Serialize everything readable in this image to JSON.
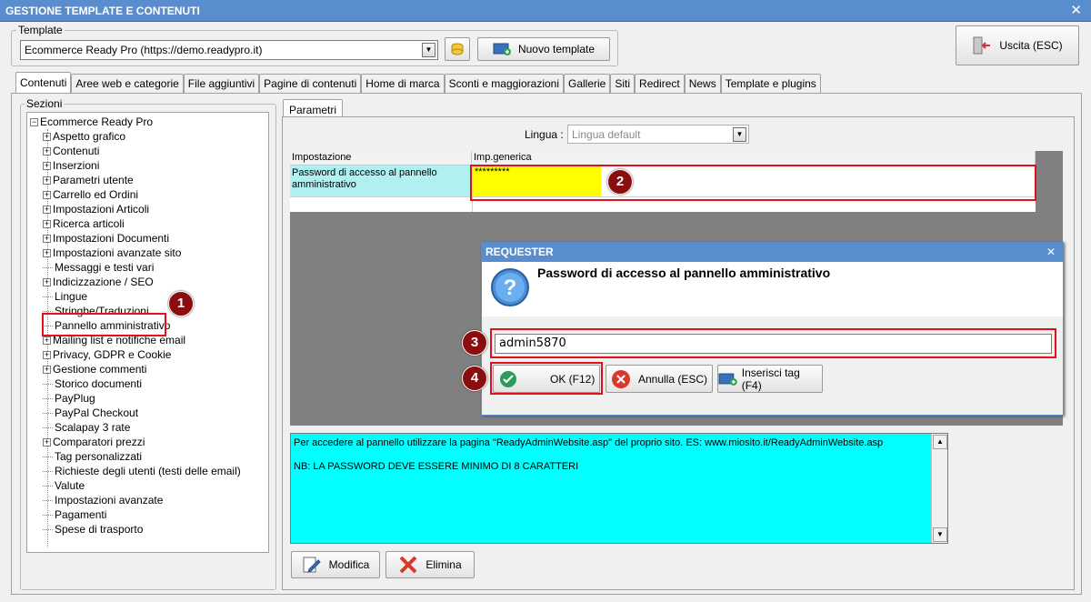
{
  "window": {
    "title": "GESTIONE TEMPLATE E CONTENUTI",
    "close_glyph": "✕"
  },
  "template": {
    "group_label": "Template",
    "selected": "Ecommerce Ready Pro (https://demo.readypro.it)",
    "new_button": "Nuovo template",
    "exit_button": "Uscita (ESC)"
  },
  "tabs": [
    "Contenuti",
    "Aree web e categorie",
    "File aggiuntivi",
    "Pagine di contenuti",
    "Home di marca",
    "Sconti e maggiorazioni",
    "Gallerie",
    "Siti",
    "Redirect",
    "News",
    "Template e plugins"
  ],
  "sections": {
    "label": "Sezioni",
    "root": "Ecommerce Ready Pro",
    "items": [
      {
        "label": "Aspetto grafico",
        "expand": true
      },
      {
        "label": "Contenuti",
        "expand": true
      },
      {
        "label": "Inserzioni",
        "expand": true
      },
      {
        "label": "Parametri utente",
        "expand": true
      },
      {
        "label": "Carrello ed Ordini",
        "expand": true
      },
      {
        "label": "Impostazioni Articoli",
        "expand": true
      },
      {
        "label": "Ricerca articoli",
        "expand": true
      },
      {
        "label": "Impostazioni Documenti",
        "expand": true
      },
      {
        "label": "Impostazioni avanzate sito",
        "expand": true
      },
      {
        "label": "Messaggi e testi vari",
        "expand": false
      },
      {
        "label": "Indicizzazione / SEO",
        "expand": true
      },
      {
        "label": "Lingue",
        "expand": false
      },
      {
        "label": "Stringhe/Traduzioni",
        "expand": false
      },
      {
        "label": "Pannello amministrativo",
        "expand": false
      },
      {
        "label": "Mailing list e notifiche email",
        "expand": true
      },
      {
        "label": "Privacy, GDPR e Cookie",
        "expand": true
      },
      {
        "label": "Gestione commenti",
        "expand": true
      },
      {
        "label": "Storico documenti",
        "expand": false
      },
      {
        "label": "PayPlug",
        "expand": false
      },
      {
        "label": "PayPal Checkout",
        "expand": false
      },
      {
        "label": "Scalapay 3 rate",
        "expand": false
      },
      {
        "label": "Comparatori prezzi",
        "expand": true
      },
      {
        "label": "Tag personalizzati",
        "expand": false
      },
      {
        "label": "Richieste degli utenti (testi delle email)",
        "expand": false
      },
      {
        "label": "Valute",
        "expand": false
      },
      {
        "label": "Impostazioni avanzate",
        "expand": false
      },
      {
        "label": "Pagamenti",
        "expand": false
      },
      {
        "label": "Spese di trasporto",
        "expand": false
      }
    ]
  },
  "params": {
    "tab": "Parametri",
    "lingua_label": "Lingua :",
    "lingua_value": "Lingua default",
    "col_setting": "Impostazione",
    "col_value": "Imp.generica",
    "row_setting": "Password di accesso al pannello amministrativo",
    "row_value": "*********"
  },
  "requester": {
    "title": "REQUESTER",
    "question": "Password di accesso al pannello amministrativo",
    "input_value": "admin5870",
    "ok": "OK (F12)",
    "cancel": "Annulla (ESC)",
    "insert_tag": "Inserisci tag (F4)"
  },
  "info": {
    "line1": "Per accedere al pannello utilizzare la pagina \"ReadyAdminWebsite.asp\" del proprio sito. ES: www.miosito.it/ReadyAdminWebsite.asp",
    "line2": "NB: LA PASSWORD DEVE ESSERE MINIMO DI 8 CARATTERI"
  },
  "actions": {
    "edit": "Modifica",
    "delete": "Elimina"
  },
  "badges": [
    "1",
    "2",
    "3",
    "4"
  ],
  "colors": {
    "title_bar": "#5a8dce",
    "highlight_red": "#e0111b",
    "badge": "#8b0d0d",
    "cyan_info": "#00ffff",
    "selected_cell": "#ffff00",
    "setting_cell": "#b0f0f0"
  }
}
